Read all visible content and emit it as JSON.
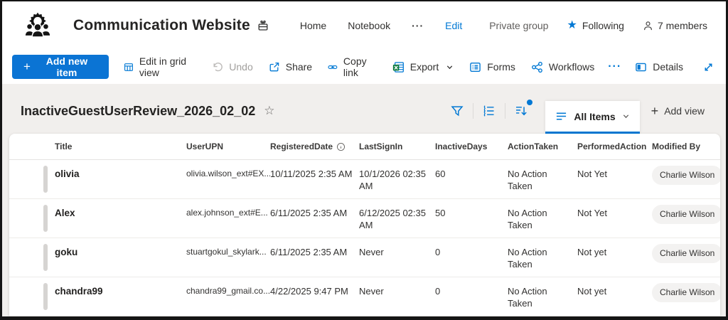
{
  "colors": {
    "accent": "#0078d4",
    "button_bg": "#0b74d4",
    "pill_bg": "#f3f2f1",
    "band_bg": "#f1efed"
  },
  "icons": {
    "site_logo": "people-with-gear-icon",
    "site_type": "briefcase-group-icon",
    "following": "star-filled-icon",
    "members": "person-outline-icon",
    "add_new": "plus-icon",
    "edit_grid": "grid-table-icon",
    "undo": "undo-arrow-icon",
    "share": "share-box-arrow-icon",
    "copy_link": "chain-link-icon",
    "export": "excel-export-icon",
    "forms": "form-lines-icon",
    "workflows": "connected-nodes-icon",
    "details": "open-pane-icon",
    "expand": "diagonal-resize-arrows-icon",
    "filter": "funnel-icon",
    "outline": "grouping-list-icon",
    "sort": "sort-arrow-icon",
    "view_tab": "list-lines-icon",
    "title_star": "star-outline-icon",
    "registered_info": "info-circle-icon"
  },
  "site_header": {
    "site_name": "Communication Website",
    "nav_items": [
      {
        "label": "Home"
      },
      {
        "label": "Notebook"
      }
    ],
    "nav_overflow": "···",
    "edit_label": "Edit",
    "privacy_label": "Private group",
    "following_label": "Following",
    "members_label": "7 members"
  },
  "command_bar": {
    "add_new_item_label": "Add new item",
    "edit_grid_label": "Edit in grid view",
    "undo_label": "Undo",
    "share_label": "Share",
    "copy_link_label": "Copy link",
    "export_label": "Export",
    "forms_label": "Forms",
    "workflows_label": "Workflows",
    "overflow": "···",
    "details_label": "Details"
  },
  "view_bar": {
    "list_title": "InactiveGuestUserReview_2026_02_02",
    "view_tab_label": "All Items",
    "add_view_label": "Add view",
    "add_view_plus": "+"
  },
  "table": {
    "columns": [
      {
        "label": "Title"
      },
      {
        "label": "UserUPN"
      },
      {
        "label": "RegisteredDate",
        "info": true
      },
      {
        "label": "LastSignIn"
      },
      {
        "label": "InactiveDays"
      },
      {
        "label": "ActionTaken"
      },
      {
        "label": "PerformedAction"
      },
      {
        "label": "Modified By"
      }
    ],
    "rows": [
      {
        "title": "olivia",
        "user_upn": "olivia.wilson_ext#EX...",
        "registered_date": "10/11/2025 2:35 AM",
        "last_sign_in": "10/1/2026 02:35 AM",
        "inactive_days": "60",
        "action_taken": "No Action Taken",
        "performed_action": "Not Yet",
        "modified_by": "Charlie Wilson"
      },
      {
        "title": "Alex",
        "user_upn": "alex.johnson_ext#E...",
        "registered_date": "6/11/2025 2:35 AM",
        "last_sign_in": "6/12/2025 02:35 AM",
        "inactive_days": "50",
        "action_taken": "No Action Taken",
        "performed_action": "Not Yet",
        "modified_by": "Charlie Wilson"
      },
      {
        "title": "goku",
        "user_upn": "stuartgokul_skylark...",
        "registered_date": "6/11/2025 2:35 AM",
        "last_sign_in": "Never",
        "inactive_days": "0",
        "action_taken": "No Action Taken",
        "performed_action": "Not yet",
        "modified_by": "Charlie Wilson"
      },
      {
        "title": "chandra99",
        "user_upn": "chandra99_gmail.co...",
        "registered_date": "4/22/2025 9:47 PM",
        "last_sign_in": "Never",
        "inactive_days": "0",
        "action_taken": "No Action Taken",
        "performed_action": "Not yet",
        "modified_by": "Charlie Wilson"
      }
    ]
  }
}
